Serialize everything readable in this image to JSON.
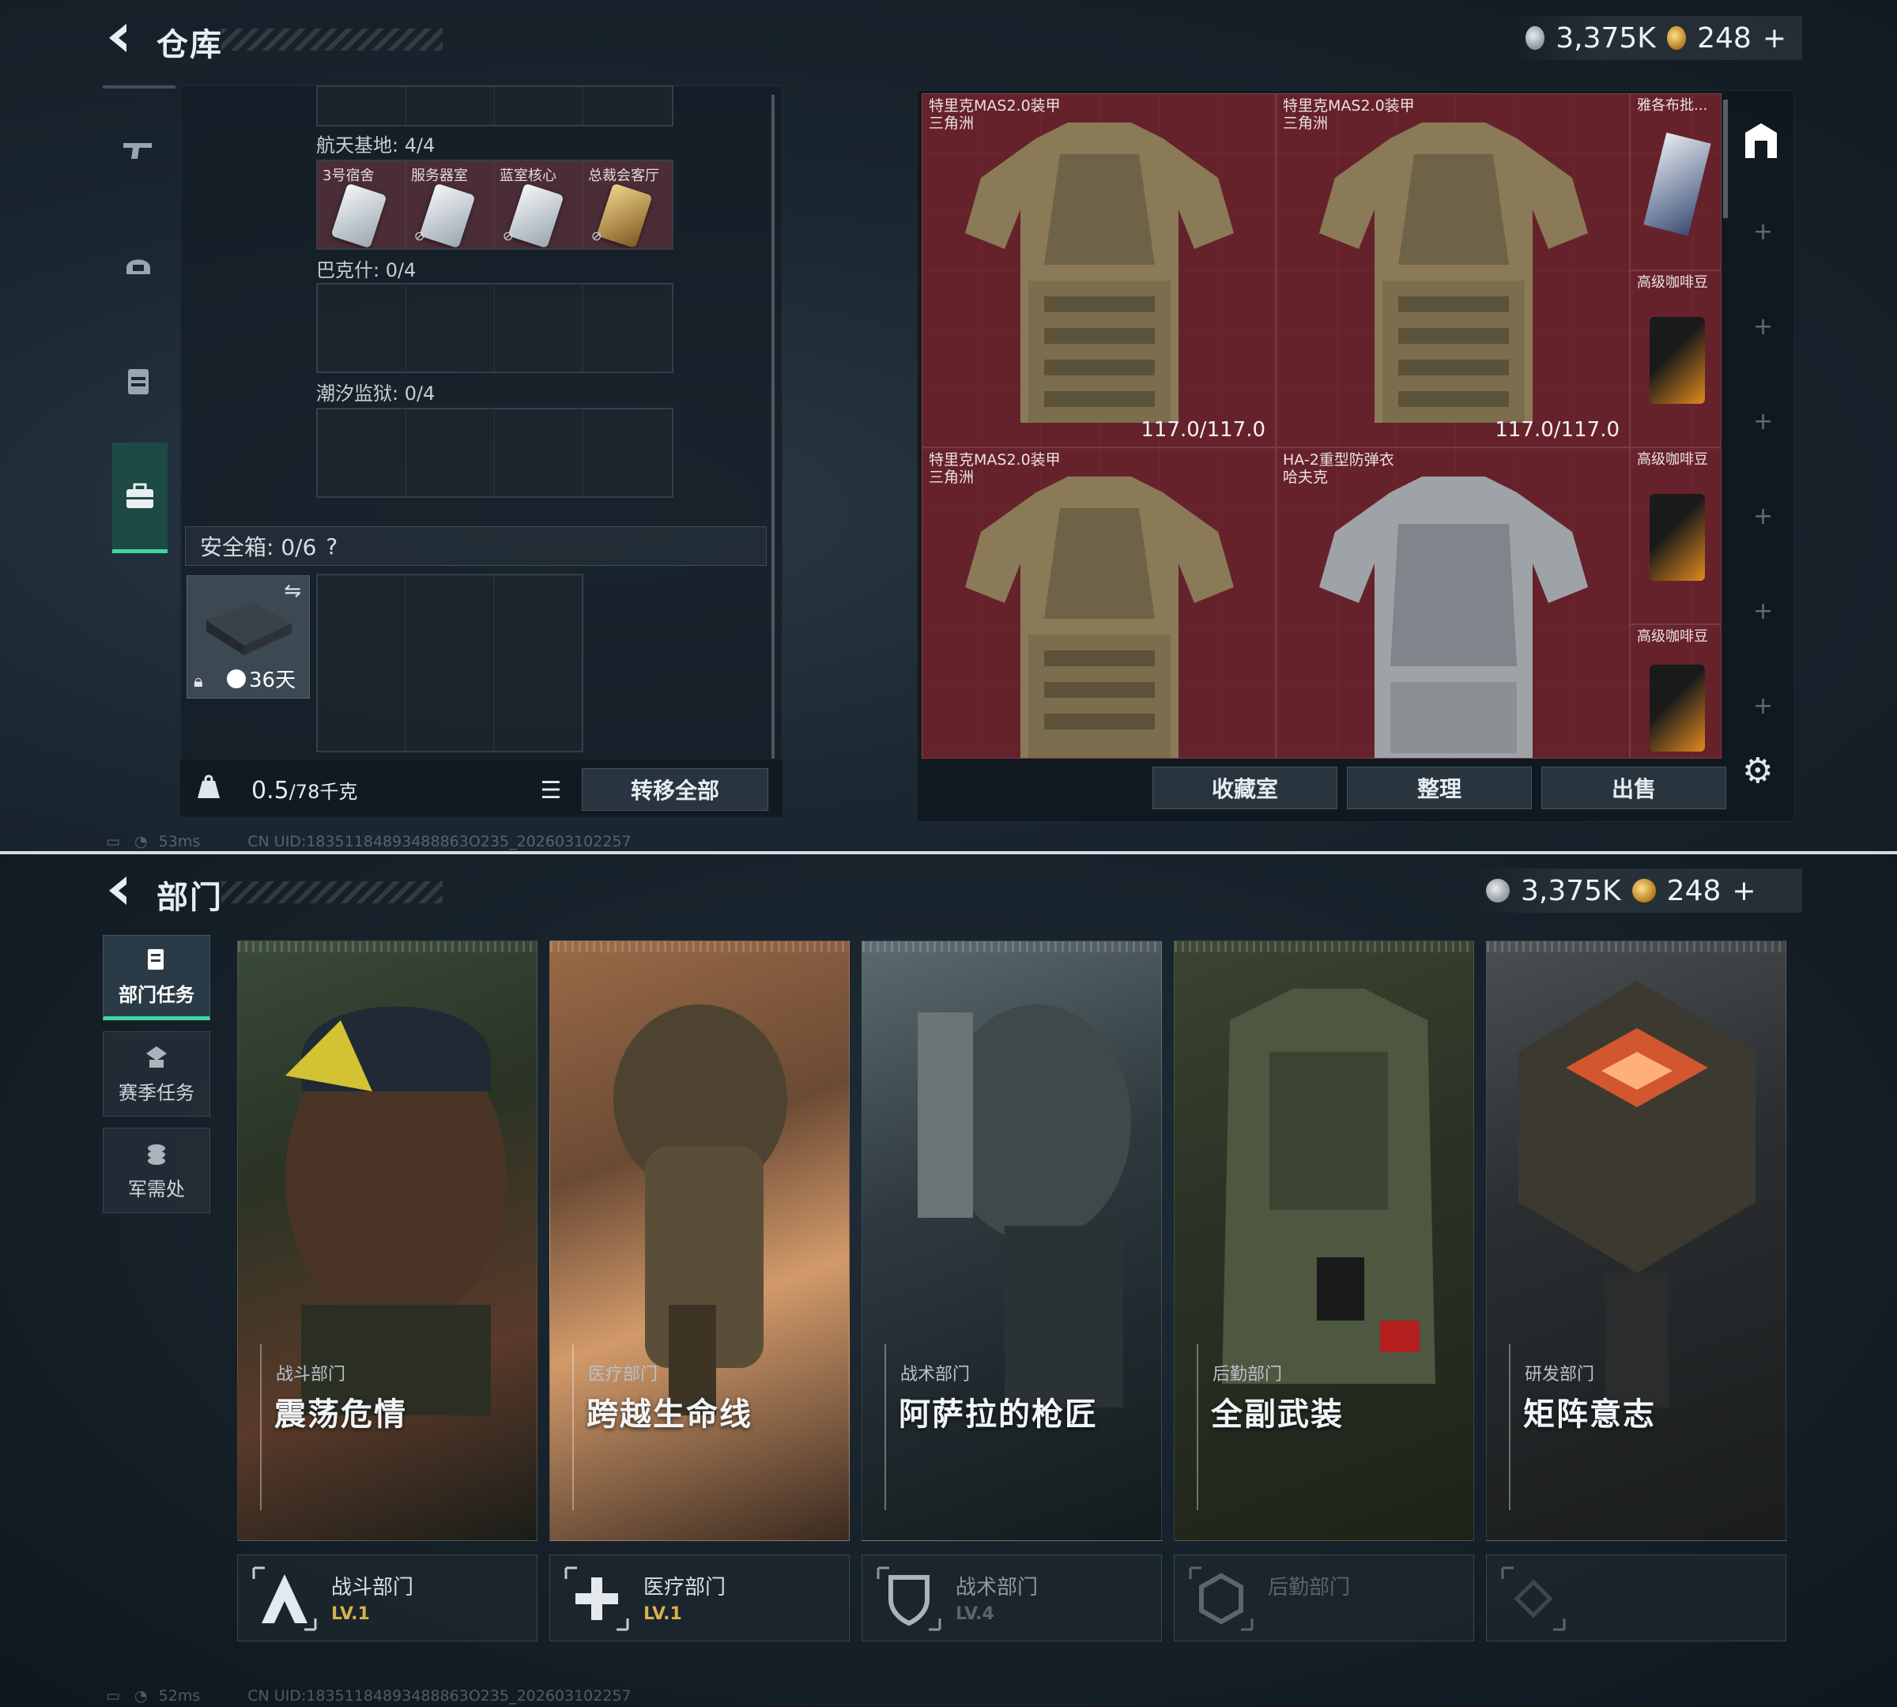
{
  "warehouse": {
    "title": "仓库",
    "currency": {
      "silver": "3,375K",
      "gold": "248",
      "gold_plus": "+"
    },
    "sections": [
      {
        "label": "航天基地: 4/4",
        "cards": [
          "3号宿舍",
          "服务器室",
          "蓝室核心",
          "总裁会客厅"
        ]
      },
      {
        "label": "巴克什: 0/4"
      },
      {
        "label": "潮汐监狱: 0/4"
      }
    ],
    "safe_box": {
      "label": "安全箱: 0/6",
      "help": "?",
      "days": "36天"
    },
    "weight": {
      "current": "0.5",
      "max": "/78千克"
    },
    "transfer_all": "转移全部",
    "stash_items": [
      {
        "name": "特里克MAS2.0装甲",
        "sub": "三角洲",
        "durability": "117.0/117.0"
      },
      {
        "name": "特里克MAS2.0装甲",
        "sub": "三角洲",
        "durability": "117.0/117.0"
      },
      {
        "name": "特里克MAS2.0装甲",
        "sub": "三角洲",
        "durability": ""
      },
      {
        "name": "HA-2重型防弹衣",
        "sub": "哈夫克",
        "durability": ""
      },
      {
        "name": "雅各布批...",
        "sub": "",
        "durability": ""
      },
      {
        "name": "高级咖啡豆",
        "sub": "",
        "durability": ""
      },
      {
        "name": "高级咖啡豆",
        "sub": "",
        "durability": ""
      },
      {
        "name": "高级咖啡豆",
        "sub": "",
        "durability": ""
      }
    ],
    "buttons": {
      "collection": "收藏室",
      "sort": "整理",
      "sell": "出售"
    },
    "status": {
      "ping": "53ms",
      "uid": "CN UID:18351184893488863O235_202603102257"
    }
  },
  "departments": {
    "title": "部门",
    "currency": {
      "silver": "3,375K",
      "gold": "248",
      "gold_plus": "+"
    },
    "tabs": [
      "部门任务",
      "赛季任务",
      "军需处"
    ],
    "cards": [
      {
        "dept": "战斗部门",
        "name": "震荡危情",
        "footer": "战斗部门",
        "level": "LV.1"
      },
      {
        "dept": "医疗部门",
        "name": "跨越生命线",
        "footer": "医疗部门",
        "level": "LV.1"
      },
      {
        "dept": "战术部门",
        "name": "阿萨拉的枪匠",
        "footer": "战术部门",
        "level": "LV.4"
      },
      {
        "dept": "后勤部门",
        "name": "全副武装",
        "footer": "后勤部门",
        "level": ""
      },
      {
        "dept": "研发部门",
        "name": "矩阵意志",
        "footer": "",
        "level": ""
      }
    ],
    "status": {
      "ping": "52ms",
      "uid": "CN UID:18351184893488863O235_202603102257"
    }
  }
}
